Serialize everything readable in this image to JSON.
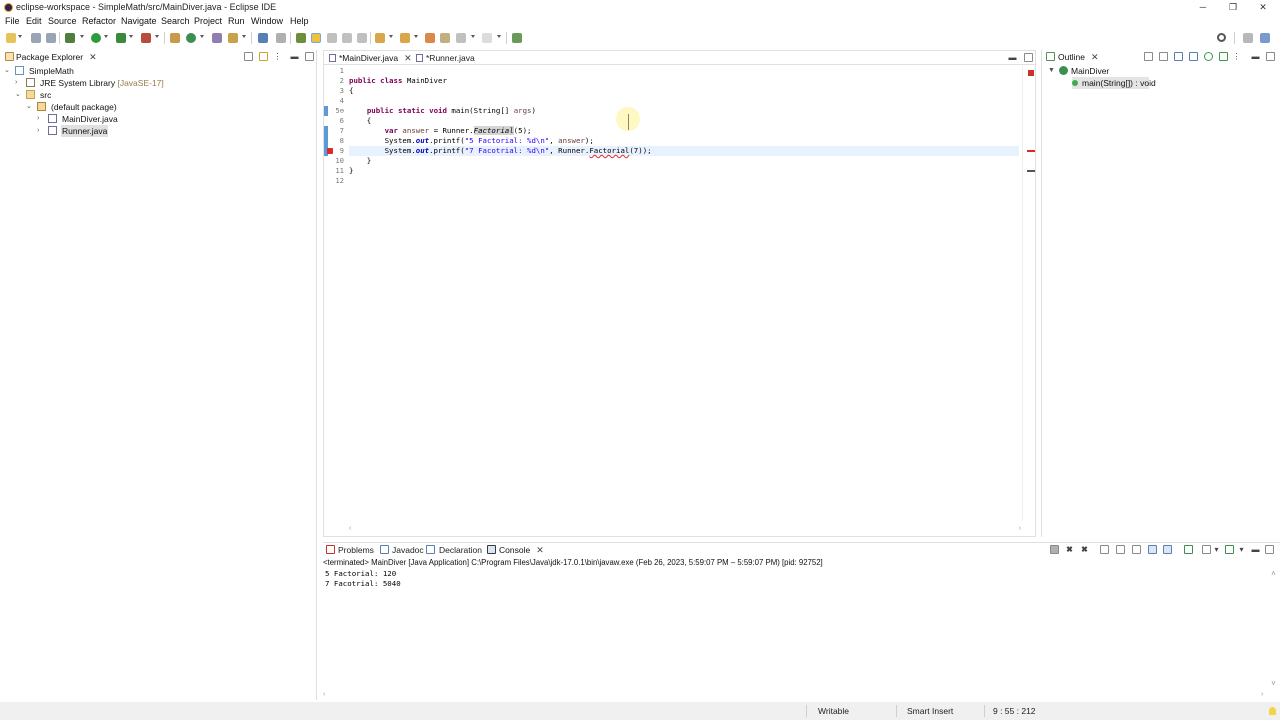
{
  "window": {
    "title": "eclipse-workspace - SimpleMath/src/MainDiver.java - Eclipse IDE",
    "minimize": "─",
    "restore": "❐",
    "close": "✕"
  },
  "menu": [
    "File",
    "Edit",
    "Source",
    "Refactor",
    "Navigate",
    "Search",
    "Project",
    "Run",
    "Window",
    "Help"
  ],
  "package_explorer": {
    "tab_label": "Package Explorer",
    "tree": [
      {
        "label": "SimpleMath",
        "level": 0,
        "twisty": "expanded",
        "icon": "project-icon"
      },
      {
        "label": "JRE System Library",
        "suffix": "[JavaSE-17]",
        "level": 1,
        "twisty": "collapsed",
        "icon": "library-icon"
      },
      {
        "label": "src",
        "level": 1,
        "twisty": "expanded",
        "icon": "source-folder-icon"
      },
      {
        "label": "(default package)",
        "level": 2,
        "twisty": "expanded",
        "icon": "package-icon"
      },
      {
        "label": "MainDiver.java",
        "level": 3,
        "twisty": "collapsed",
        "icon": "java-file-icon"
      },
      {
        "label": "Runner.java",
        "level": 3,
        "twisty": "collapsed",
        "icon": "java-file-icon",
        "selected": true
      }
    ]
  },
  "editor": {
    "tabs": [
      {
        "label": "*MainDiver.java",
        "active": true
      },
      {
        "label": "*Runner.java",
        "active": false
      }
    ],
    "line_numbers": [
      "1",
      "2",
      "3",
      "4",
      "5⊖",
      "6",
      "7",
      "8",
      "9",
      "10",
      "11",
      "12"
    ]
  },
  "outline": {
    "tab_label": "Outline",
    "class_name": "MainDiver",
    "method": "main(String[]) : void"
  },
  "bottom_panel": {
    "tabs": [
      "Problems",
      "Javadoc",
      "Declaration",
      "Console"
    ],
    "active_tab": "Console",
    "header": "<terminated> MainDiver [Java Application] C:\\Program Files\\Java\\jdk-17.0.1\\bin\\javaw.exe  (Feb 26, 2023, 5:59:07 PM – 5:59:07 PM) [pid: 92752]",
    "output": [
      "5 Factorial: 120",
      "7 Facotrial: 5040"
    ]
  },
  "status": {
    "writable": "Writable",
    "insert_mode": "Smart Insert",
    "position": "9 : 55 : 212"
  },
  "colors": {
    "keyword": "#7f0055",
    "string": "#2a00ff",
    "static_field": "#0000c0",
    "line_highlight": "#e8f2fe",
    "change_bar": "#5b9bd5",
    "error": "#e0282b"
  }
}
